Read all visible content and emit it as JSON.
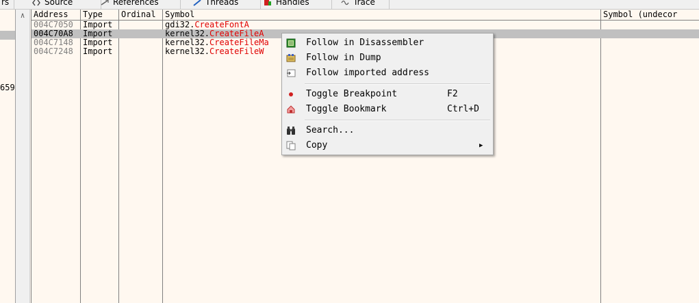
{
  "tabs": [
    {
      "label": "rs",
      "icon": "tab-icon"
    },
    {
      "label": "Source",
      "icon": "source-icon"
    },
    {
      "label": "References",
      "icon": "references-icon"
    },
    {
      "label": "Threads",
      "icon": "threads-icon"
    },
    {
      "label": "Handles",
      "icon": "handles-icon"
    },
    {
      "label": "Trace",
      "icon": "trace-icon"
    }
  ],
  "left_panel": {
    "value": "659"
  },
  "table": {
    "headers": [
      "Address",
      "Type",
      "Ordinal",
      "Symbol",
      "Symbol (undecor"
    ],
    "rows": [
      {
        "address": "004C7050",
        "type": "Import",
        "ordinal": "",
        "module": "gdi32.",
        "function": "CreateFontA"
      },
      {
        "address": "004C70A8",
        "type": "Import",
        "ordinal": "",
        "module": "kernel32.",
        "function": "CreateFileA"
      },
      {
        "address": "004C7148",
        "type": "Import",
        "ordinal": "",
        "module": "kernel32.",
        "function": "CreateFileMa"
      },
      {
        "address": "004C7248",
        "type": "Import",
        "ordinal": "",
        "module": "kernel32.",
        "function": "CreateFileW"
      }
    ]
  },
  "menu": {
    "items": [
      {
        "label": "Follow in Disassembler",
        "shortcut": "",
        "icon": "disassembler-icon"
      },
      {
        "label": "Follow in Dump",
        "shortcut": "",
        "icon": "dump-icon"
      },
      {
        "label": "Follow imported address",
        "shortcut": "",
        "icon": "imported-address-icon"
      },
      {
        "label": "Toggle Breakpoint",
        "shortcut": "F2",
        "icon": "breakpoint-icon"
      },
      {
        "label": "Toggle Bookmark",
        "shortcut": "Ctrl+D",
        "icon": "bookmark-icon"
      },
      {
        "label": "Search...",
        "shortcut": "",
        "icon": "binoculars-icon"
      },
      {
        "label": "Copy",
        "shortcut": "",
        "icon": "copy-icon"
      }
    ]
  },
  "colors": {
    "background": "#fff8f0",
    "selected_row": "#c0c0c0",
    "function_name": "#e00000",
    "address_dim": "#808080"
  }
}
